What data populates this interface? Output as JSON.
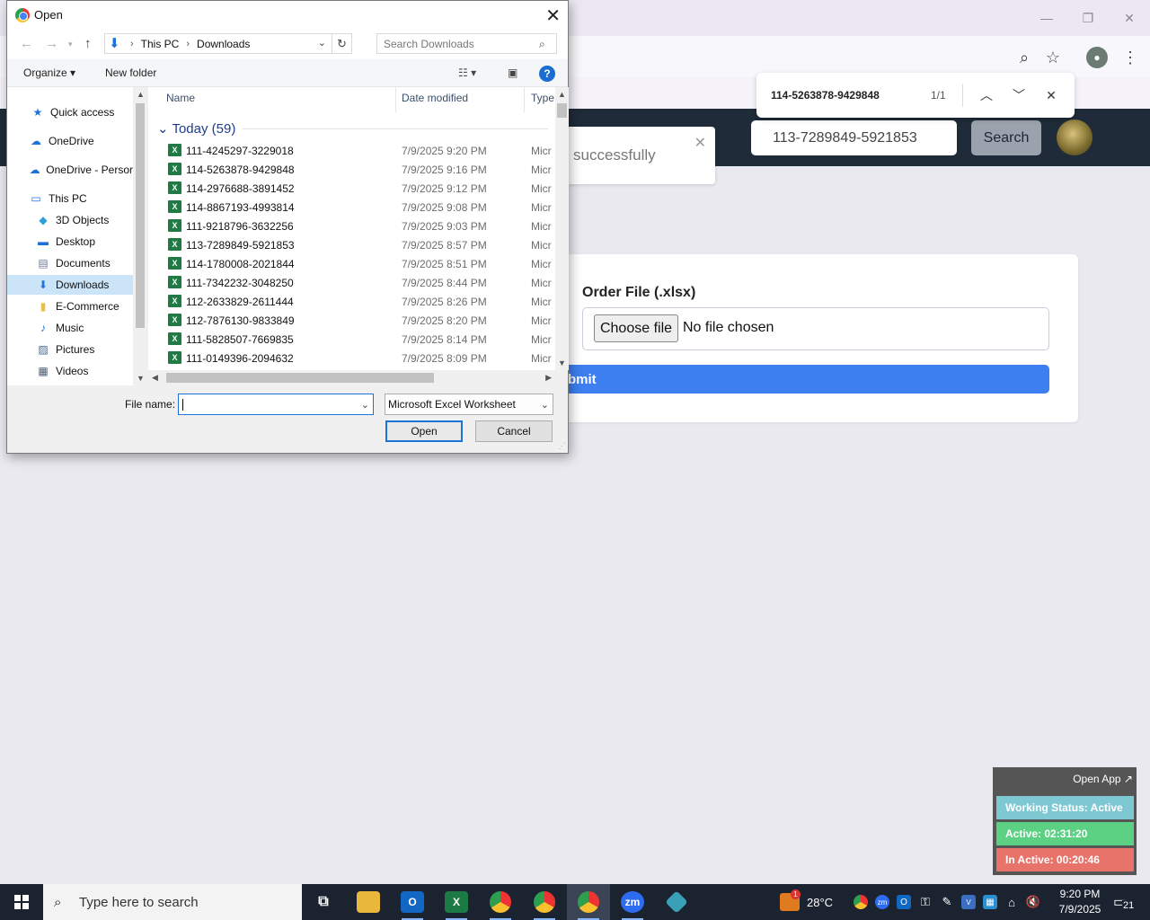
{
  "browser": {
    "window_controls": [
      "—",
      "❐",
      "✕"
    ],
    "find_bar": {
      "query": "114-5263878-9429848",
      "count": "1/1"
    }
  },
  "site": {
    "header_search_value": "113-7289849-5921853",
    "header_search_button": "Search",
    "toast_text": "successfully",
    "form": {
      "order_label": "Order File (.xlsx)",
      "choose_button": "Choose file",
      "no_file": "No file chosen",
      "submit_label": "bmit"
    }
  },
  "status_widget": {
    "open_app": "Open App ↗",
    "working_status": "Working Status: Active",
    "active": "Active: 02:31:20",
    "inactive": "In Active: 00:20:46",
    "colors": {
      "working": "#7ec8d4",
      "active": "#5dd183",
      "inactive": "#e8736b"
    }
  },
  "dialog": {
    "title": "Open",
    "breadcrumb": [
      "This PC",
      "Downloads"
    ],
    "search_placeholder": "Search Downloads",
    "organize": "Organize ▾",
    "new_folder": "New folder",
    "nav_items": [
      {
        "label": "Quick access",
        "icon": "star-icon"
      },
      {
        "label": "OneDrive",
        "icon": "cloud-icon"
      },
      {
        "label": "OneDrive - Persor",
        "icon": "cloud-icon"
      },
      {
        "label": "This PC",
        "icon": "computer-icon"
      },
      {
        "label": "3D Objects",
        "icon": "cube-icon"
      },
      {
        "label": "Desktop",
        "icon": "desktop-icon"
      },
      {
        "label": "Documents",
        "icon": "document-icon"
      },
      {
        "label": "Downloads",
        "icon": "download-icon"
      },
      {
        "label": "E-Commerce",
        "icon": "folder-icon"
      },
      {
        "label": "Music",
        "icon": "music-icon"
      },
      {
        "label": "Pictures",
        "icon": "picture-icon"
      },
      {
        "label": "Videos",
        "icon": "video-icon"
      }
    ],
    "columns": [
      "Name",
      "Date modified",
      "Type"
    ],
    "group": "Today (59)",
    "files": [
      {
        "name": "111-4245297-3229018",
        "date": "7/9/2025 9:20 PM",
        "type": "Micr"
      },
      {
        "name": "114-5263878-9429848",
        "date": "7/9/2025 9:16 PM",
        "type": "Micr"
      },
      {
        "name": "114-2976688-3891452",
        "date": "7/9/2025 9:12 PM",
        "type": "Micr"
      },
      {
        "name": "114-8867193-4993814",
        "date": "7/9/2025 9:08 PM",
        "type": "Micr"
      },
      {
        "name": "111-9218796-3632256",
        "date": "7/9/2025 9:03 PM",
        "type": "Micr"
      },
      {
        "name": "113-7289849-5921853",
        "date": "7/9/2025 8:57 PM",
        "type": "Micr"
      },
      {
        "name": "114-1780008-2021844",
        "date": "7/9/2025 8:51 PM",
        "type": "Micr"
      },
      {
        "name": "111-7342232-3048250",
        "date": "7/9/2025 8:44 PM",
        "type": "Micr"
      },
      {
        "name": "112-2633829-2611444",
        "date": "7/9/2025 8:26 PM",
        "type": "Micr"
      },
      {
        "name": "112-7876130-9833849",
        "date": "7/9/2025 8:20 PM",
        "type": "Micr"
      },
      {
        "name": "111-5828507-7669835",
        "date": "7/9/2025 8:14 PM",
        "type": "Micr"
      },
      {
        "name": "111-0149396-2094632",
        "date": "7/9/2025 8:09 PM",
        "type": "Micr"
      }
    ],
    "file_name_label": "File name:",
    "file_name_value": "",
    "file_type": "Microsoft Excel Worksheet",
    "open_button": "Open",
    "cancel_button": "Cancel"
  },
  "taskbar": {
    "search_placeholder": "Type here to search",
    "weather": "28°C",
    "weather_badge": "1",
    "time": "9:20 PM",
    "date": "7/9/2025",
    "notifications": "21"
  }
}
